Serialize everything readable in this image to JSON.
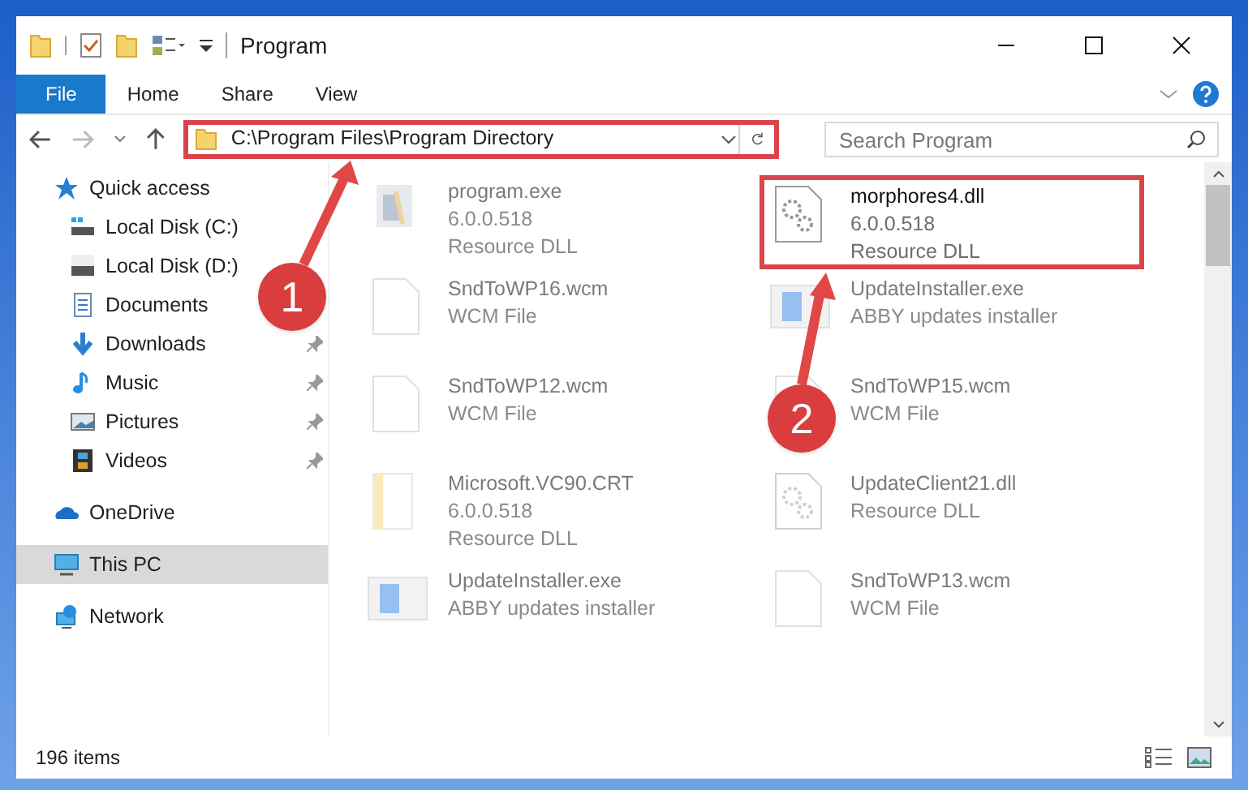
{
  "window": {
    "title": "Program"
  },
  "ribbon_tabs": [
    {
      "label": "File",
      "selected": true
    },
    {
      "label": "Home",
      "selected": false
    },
    {
      "label": "Share",
      "selected": false
    },
    {
      "label": "View",
      "selected": false
    }
  ],
  "address": {
    "path": "C:\\Program Files\\Program Directory"
  },
  "search": {
    "placeholder": "Search Program"
  },
  "sidebar": {
    "items": [
      {
        "kind": "star",
        "label": "Quick access",
        "pinned": false,
        "selected": false,
        "children": [
          {
            "kind": "disk-c",
            "label": "Local Disk (C:)",
            "pinned": false,
            "selected": false
          },
          {
            "kind": "disk",
            "label": "Local Disk (D:)",
            "pinned": false,
            "selected": false
          },
          {
            "kind": "documents",
            "label": "Documents",
            "pinned": false,
            "selected": false
          },
          {
            "kind": "downloads",
            "label": "Downloads",
            "pinned": true,
            "selected": false
          },
          {
            "kind": "music",
            "label": "Music",
            "pinned": true,
            "selected": false
          },
          {
            "kind": "pictures",
            "label": "Pictures",
            "pinned": true,
            "selected": false
          },
          {
            "kind": "videos",
            "label": "Videos",
            "pinned": true,
            "selected": false
          }
        ]
      },
      {
        "kind": "cloud",
        "label": "OneDrive",
        "pinned": false,
        "selected": false
      },
      {
        "kind": "pc",
        "label": "This PC",
        "pinned": false,
        "selected": true
      },
      {
        "kind": "network",
        "label": "Network",
        "pinned": false,
        "selected": false
      }
    ]
  },
  "files": [
    {
      "kind": "exe",
      "name": "program.exe",
      "details": [
        "6.0.0.518",
        "Resource DLL"
      ],
      "blurred": true,
      "highlighted": false
    },
    {
      "kind": "dll",
      "name": "morphores4.dll",
      "details": [
        "6.0.0.518",
        "Resource DLL"
      ],
      "blurred": false,
      "highlighted": true
    },
    {
      "kind": "doc",
      "name": "SndToWP16.wcm",
      "details": [
        "WCM File"
      ],
      "blurred": true,
      "highlighted": false
    },
    {
      "kind": "installer",
      "name": "UpdateInstaller.exe",
      "details": [
        "ABBY updates installer"
      ],
      "blurred": true,
      "highlighted": false
    },
    {
      "kind": "doc",
      "name": "SndToWP12.wcm",
      "details": [
        "WCM File"
      ],
      "blurred": true,
      "highlighted": false
    },
    {
      "kind": "doc",
      "name": "SndToWP15.wcm",
      "details": [
        "WCM File"
      ],
      "blurred": true,
      "highlighted": false
    },
    {
      "kind": "folder",
      "name": "Microsoft.VC90.CRT",
      "details": [
        "6.0.0.518",
        "Resource DLL"
      ],
      "blurred": true,
      "highlighted": false
    },
    {
      "kind": "dll",
      "name": "UpdateClient21.dll",
      "details": [
        "Resource DLL"
      ],
      "blurred": true,
      "highlighted": false
    },
    {
      "kind": "installer",
      "name": "UpdateInstaller.exe",
      "details": [
        "ABBY updates installer"
      ],
      "blurred": true,
      "highlighted": false
    },
    {
      "kind": "doc",
      "name": "SndToWP13.wcm",
      "details": [
        "WCM File"
      ],
      "blurred": true,
      "highlighted": false
    }
  ],
  "status_bar": {
    "count": "196 items"
  },
  "callouts": [
    {
      "number": "1"
    },
    {
      "number": "2"
    }
  ]
}
